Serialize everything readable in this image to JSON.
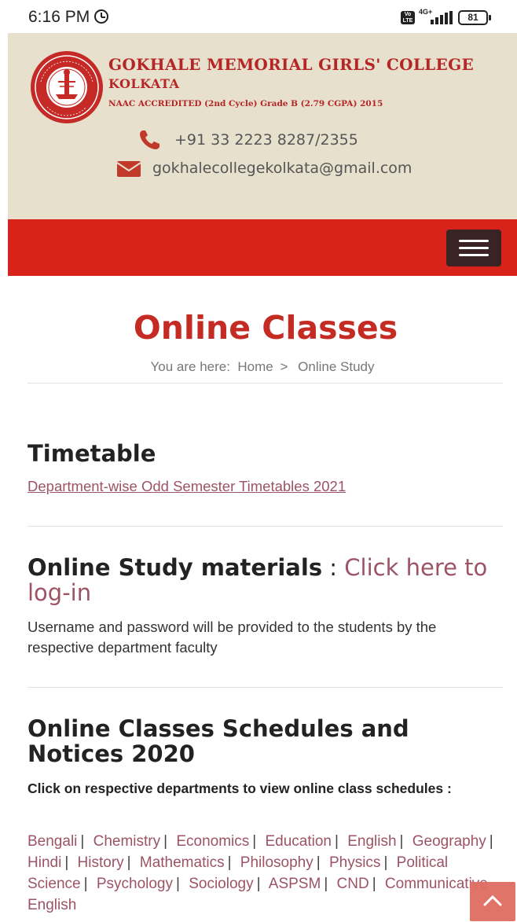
{
  "status_bar": {
    "time": "6:16 PM",
    "network": "4G+",
    "volte": "Vo LTE",
    "battery": "81",
    "icons": [
      "alarm-icon",
      "volte-icon",
      "signal-icon",
      "battery-icon"
    ]
  },
  "header": {
    "college_name": "GOKHALE MEMORIAL GIRLS' COLLEGE",
    "city": "KOLKATA",
    "naac": "NAAC ACCREDITED (2nd Cycle) Grade B (2.79 CGPA) 2015",
    "logo_text": "GOKHALE MEMORIAL GIRLS' COLLEGE",
    "logo_estd": "ESTD 1938",
    "phone": "+91 33 2223 8287/2355",
    "email": "gokhalecollegekolkata@gmail.com",
    "colors": {
      "header_bg": "#e7e0cd",
      "brand_red": "#b52626",
      "nav_red": "#d8231a"
    }
  },
  "nav": {
    "menu_icon": "hamburger-menu-icon"
  },
  "page": {
    "title": "Online Classes",
    "breadcrumb": {
      "prefix": "You are here:",
      "home": "Home",
      "separator": ">",
      "current": "Online Study"
    }
  },
  "timetable": {
    "heading": "Timetable",
    "link": "Department-wise Odd Semester Timetables 2021"
  },
  "online_study": {
    "heading": "Online Study materials",
    "colon": ":",
    "link": "Click here to log-in",
    "note": "Username and password will be provided to the students by the respective department faculty"
  },
  "schedules": {
    "heading": "Online Classes Schedules and Notices 2020",
    "sub": "Click on respective departments to view online class schedules :",
    "departments": [
      "Bengali",
      "Chemistry",
      "Economics",
      "Education",
      "English",
      "Geography",
      "Hindi",
      "History",
      "Mathematics",
      "Philosophy",
      "Physics",
      "Political Science",
      "Psychology",
      "Sociology",
      "ASPSM",
      "CND",
      "Communicative English"
    ]
  },
  "scroll_top": {
    "icon": "chevron-up-icon"
  }
}
